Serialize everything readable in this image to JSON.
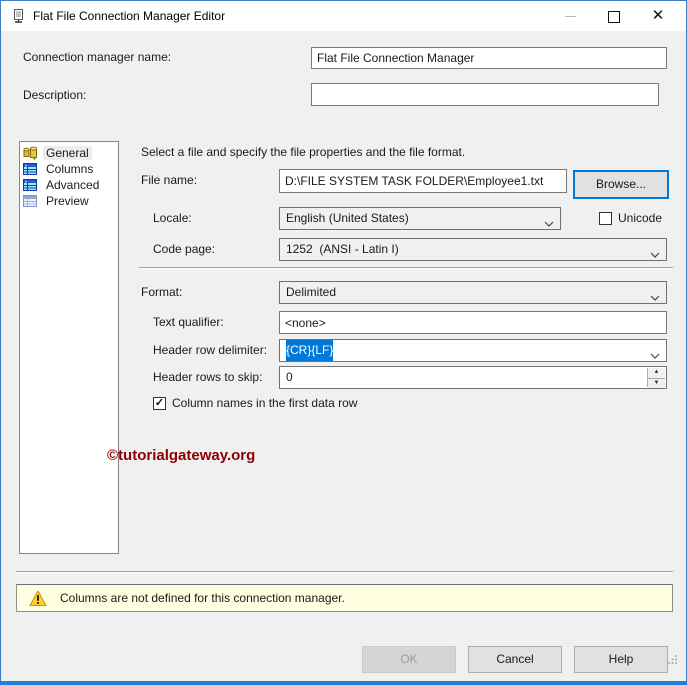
{
  "window": {
    "title": "Flat File Connection Manager Editor"
  },
  "icons": {
    "app": "flat-file-icon",
    "minimize": "css-dash",
    "maximize": "css-square",
    "close": "✕",
    "chevron": "css-chevron",
    "check": "✓",
    "spin_up": "▲",
    "spin_down": "▼",
    "warning": "warning-triangle",
    "sidebar_general": "connection-gold-icon",
    "sidebar_columns": "table-cyan-icon",
    "sidebar_advanced": "table-cyan-icon",
    "sidebar_preview": "table-light-icon"
  },
  "header_form": {
    "name_label": "Connection manager name:",
    "name_value": "Flat File Connection Manager",
    "description_label": "Description:",
    "description_value": ""
  },
  "sidebar": {
    "items": [
      {
        "label": "General",
        "selected": true
      },
      {
        "label": "Columns",
        "selected": false
      },
      {
        "label": "Advanced",
        "selected": false
      },
      {
        "label": "Preview",
        "selected": false
      }
    ]
  },
  "general_pane": {
    "intro": "Select a file and specify the file properties and the file format.",
    "file_name": {
      "label": "File name:",
      "value": "D:\\FILE SYSTEM TASK FOLDER\\Employee1.txt"
    },
    "browse_label": "Browse...",
    "locale": {
      "label": "Locale:",
      "value": "English (United States)"
    },
    "unicode": {
      "label": "Unicode",
      "checked": false
    },
    "code_page": {
      "label": "Code page:",
      "value": "1252  (ANSI - Latin I)"
    },
    "format": {
      "label": "Format:",
      "value": "Delimited"
    },
    "text_qualifier": {
      "label": "Text qualifier:",
      "value": "<none>"
    },
    "header_row_delimiter": {
      "label": "Header row delimiter:",
      "value": "{CR}{LF}",
      "selection": "full"
    },
    "header_rows_to_skip": {
      "label": "Header rows to skip:",
      "value": "0"
    },
    "column_names_checkbox": {
      "label": "Column names in the first data row",
      "checked": true
    },
    "watermark": "©tutorialgateway.org"
  },
  "warning": {
    "text": "Columns are not defined for this connection manager."
  },
  "footer": {
    "ok_label": "OK",
    "ok_enabled": false,
    "cancel_label": "Cancel",
    "help_label": "Help"
  },
  "colors": {
    "accent_blue": "#0078d7",
    "window_border_bottom": "#1883d7",
    "dialog_bg": "#f0f0f0",
    "titlebar_bg": "#ffffff",
    "warning_bg": "#fffee1",
    "watermark_red": "#8b0000",
    "selection_bg": "#0078d7"
  }
}
